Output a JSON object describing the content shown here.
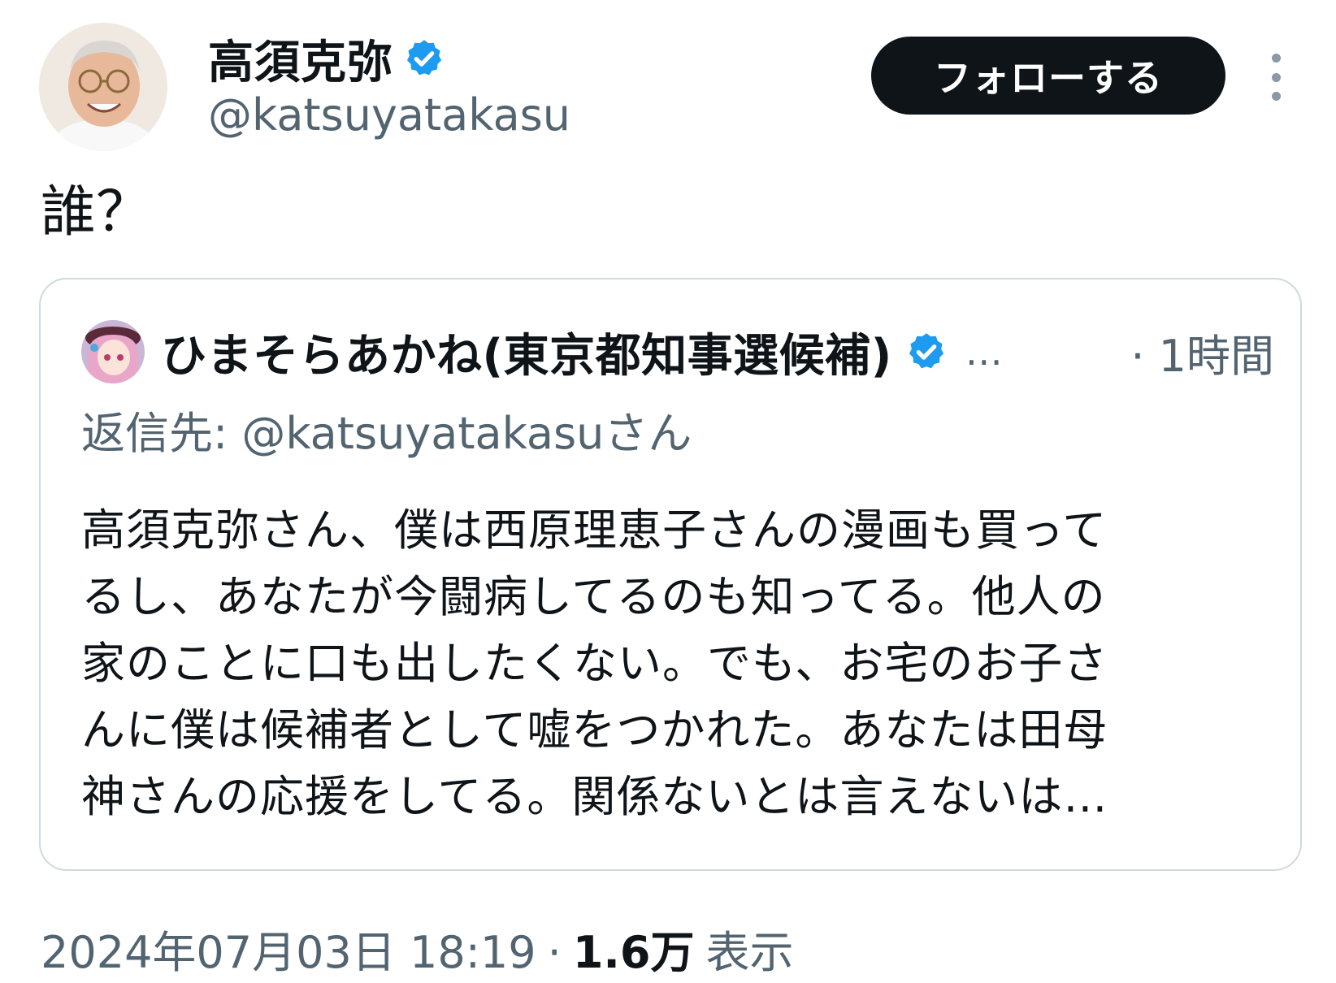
{
  "author": {
    "display_name": "高須克弥",
    "handle": "@katsuyatakasu"
  },
  "follow_label": "フォローする",
  "tweet_text": "誰？",
  "quoted": {
    "display_name": "ひまそらあかね(東京都知事選候補)",
    "ellipsis": "…",
    "time": "· 1時間",
    "reply_to": "返信先: @katsuyatakasuさん",
    "body_lines": [
      "高須克弥さん、僕は西原理恵子さんの漫画も買って",
      "るし、あなたが今闘病してるのも知ってる。他人の",
      "家のことに口も出したくない。でも、お宅のお子さ",
      "んに僕は候補者として嘘をつかれた。あなたは田母",
      "神さんの応援をしてる。関係ないとは言えないは…"
    ]
  },
  "meta": {
    "timestamp": "2024年07月03日 18:19",
    "separator": "·",
    "views_count": "1.6万",
    "views_label": "表示"
  },
  "colors": {
    "text": "#0f1419",
    "secondary": "#536471",
    "border": "#cfd9de",
    "verified": "#1d9bf0",
    "button": "#0f1419"
  },
  "icons": {
    "verified": "verified-badge-icon",
    "more": "more-options-icon"
  }
}
